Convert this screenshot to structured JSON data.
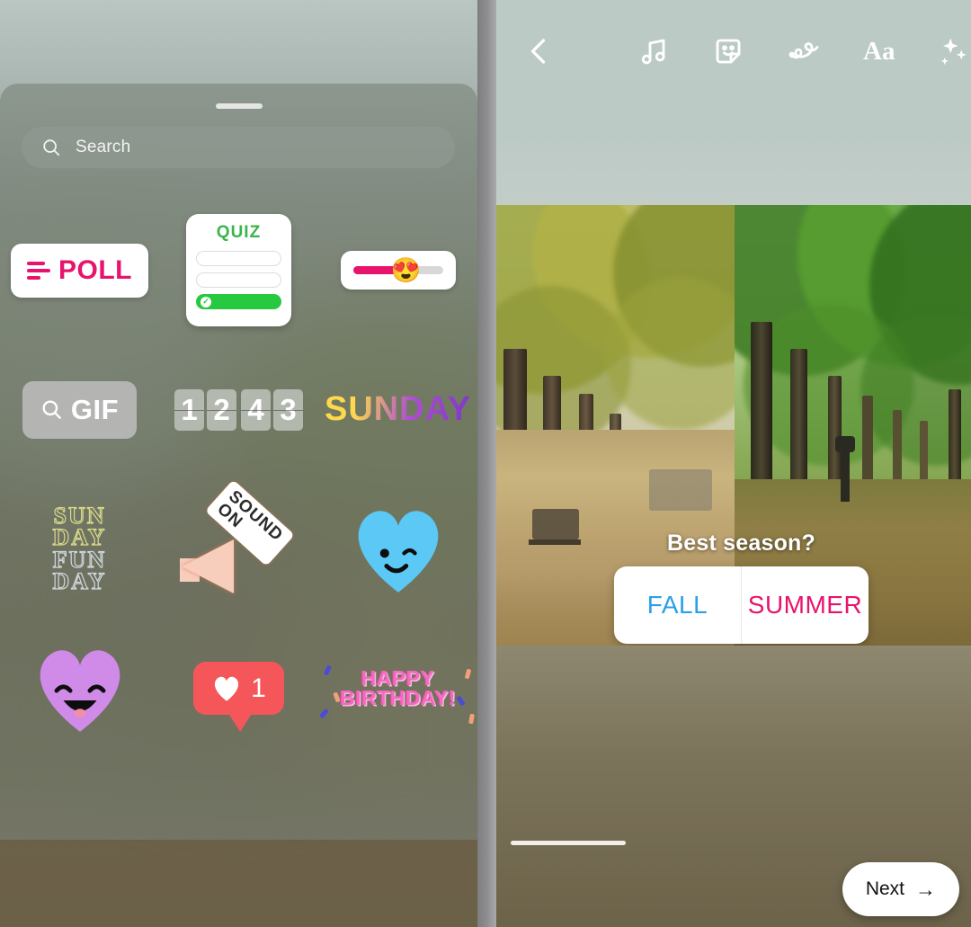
{
  "left_panel": {
    "name": "sticker-tray-sheet",
    "drag_handle": "drag-handle",
    "search": {
      "placeholder": "Search",
      "icon": "search-icon"
    },
    "stickers": [
      {
        "id": "poll",
        "label": "POLL",
        "icon": "poll-icon",
        "color": "#e8136d"
      },
      {
        "id": "quiz",
        "label": "QUIZ",
        "icon": "quiz-icon",
        "color": "#3ab54a"
      },
      {
        "id": "emoji-slider",
        "label": "",
        "icon": "slider-icon",
        "emoji": "😍",
        "color": "#e8136d"
      },
      {
        "id": "gif",
        "label": "GIF",
        "icon": "gif-search-icon",
        "color": "#ffffff"
      },
      {
        "id": "countdown",
        "label": "1243",
        "icon": "flip-digits-icon",
        "digits": [
          "1",
          "2",
          "4",
          "3"
        ]
      },
      {
        "id": "sunday",
        "label": "SUNDAY",
        "icon": "sunday-word-icon"
      },
      {
        "id": "sunday-fun-day",
        "label": "SUNDAY FUN DAY",
        "icon": "outline-text-icon",
        "lines": [
          "SUN",
          "DAY",
          "FUN",
          "DAY"
        ]
      },
      {
        "id": "sound-on",
        "label": "SOUND ON",
        "icon": "speaker-icon",
        "lines": [
          "SOUND",
          "ON"
        ]
      },
      {
        "id": "blue-heart",
        "label": "",
        "icon": "winking-heart-icon",
        "color": "#5bc8f5"
      },
      {
        "id": "purple-heart",
        "label": "",
        "icon": "smiling-heart-icon",
        "color": "#d08ae8"
      },
      {
        "id": "like-count",
        "label": "1",
        "icon": "like-bubble-icon",
        "color": "#f4565a"
      },
      {
        "id": "happy-birthday",
        "label": "HAPPY BIRTHDAY!",
        "icon": "confetti-text-icon",
        "lines": [
          "HAPPY",
          "BIRTHDAY!"
        ]
      }
    ]
  },
  "right_panel": {
    "toolbar": {
      "back": "back-chevron",
      "items": [
        {
          "id": "music",
          "name": "music-note-icon",
          "label": ""
        },
        {
          "id": "stickers",
          "name": "sticker-smiley-icon",
          "label": ""
        },
        {
          "id": "draw",
          "name": "squiggle-draw-icon",
          "label": ""
        },
        {
          "id": "text",
          "name": "text-aa-icon",
          "label": "Aa"
        },
        {
          "id": "effects",
          "name": "sparkles-icon",
          "label": ""
        }
      ]
    },
    "photo": {
      "name": "story-photo",
      "left_scene": "autumn-tree-avenue",
      "right_scene": "summer-tree-avenue"
    },
    "poll_sticker": {
      "question": "Best season?",
      "options": [
        {
          "label": "FALL",
          "color": "#2aa0e8"
        },
        {
          "label": "SUMMER",
          "color": "#e8136d"
        }
      ]
    },
    "next_button": {
      "label": "Next",
      "arrow": "→"
    }
  }
}
